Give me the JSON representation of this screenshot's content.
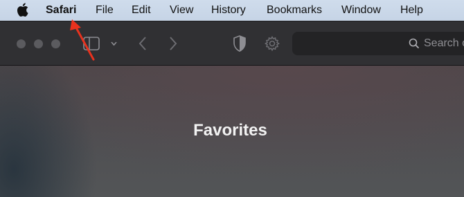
{
  "menubar": {
    "apple_icon": "apple-logo-icon",
    "items": [
      {
        "label": "Safari"
      },
      {
        "label": "File"
      },
      {
        "label": "Edit"
      },
      {
        "label": "View"
      },
      {
        "label": "History"
      },
      {
        "label": "Bookmarks"
      },
      {
        "label": "Window"
      },
      {
        "label": "Help"
      }
    ]
  },
  "toolbar": {
    "icons": [
      "sidebar-icon",
      "chevron-down-icon",
      "back-icon",
      "forward-icon",
      "privacy-shield-icon",
      "gear-icon",
      "search-icon"
    ],
    "search_placeholder": "Search o"
  },
  "content": {
    "title": "Favorites"
  },
  "annotation": {
    "arrow_color": "#e8321e"
  }
}
